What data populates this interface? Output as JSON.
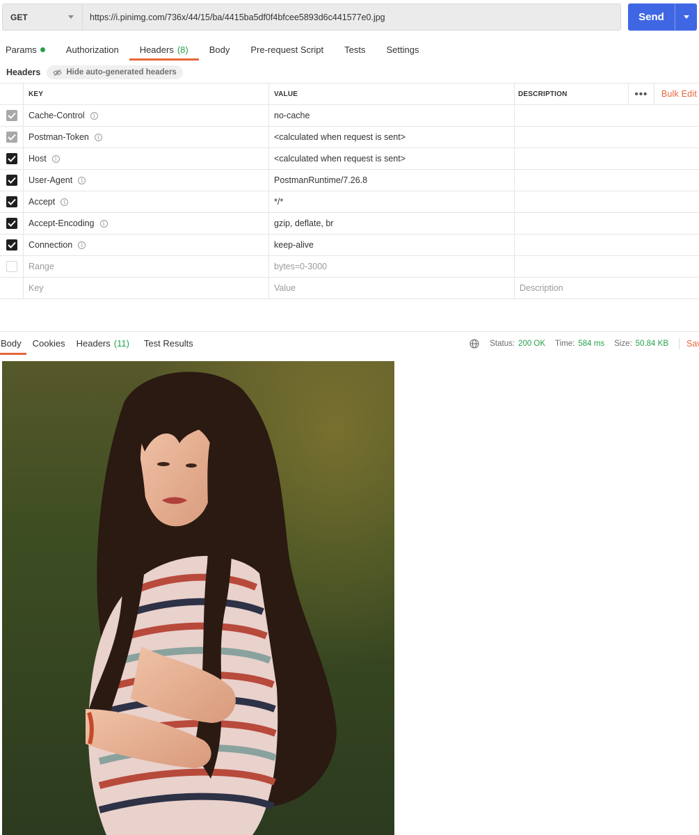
{
  "request": {
    "method": "GET",
    "url": "https://i.pinimg.com/736x/44/15/ba/4415ba5df0f4bfcee5893d6c441577e0.jpg",
    "send_label": "Send"
  },
  "request_tabs": [
    {
      "label": "Params"
    },
    {
      "label": "Authorization"
    },
    {
      "label": "Headers",
      "count": "(8)"
    },
    {
      "label": "Body"
    },
    {
      "label": "Pre-request Script"
    },
    {
      "label": "Tests"
    },
    {
      "label": "Settings"
    }
  ],
  "headers_section": {
    "title": "Headers",
    "hide_auto_label": "Hide auto-generated headers"
  },
  "table": {
    "columns": {
      "key": "KEY",
      "value": "VALUE",
      "description": "DESCRIPTION"
    },
    "more_label": "•••",
    "bulk_edit_label": "Bulk Edit",
    "rows": [
      {
        "key": "Cache-Control",
        "value": "no-cache",
        "state": "auto"
      },
      {
        "key": "Postman-Token",
        "value": "<calculated when request is sent>",
        "state": "auto"
      },
      {
        "key": "Host",
        "value": "<calculated when request is sent>",
        "state": "on"
      },
      {
        "key": "User-Agent",
        "value": "PostmanRuntime/7.26.8",
        "state": "on"
      },
      {
        "key": "Accept",
        "value": "*/*",
        "state": "on"
      },
      {
        "key": "Accept-Encoding",
        "value": "gzip, deflate, br",
        "state": "on"
      },
      {
        "key": "Connection",
        "value": "keep-alive",
        "state": "on"
      },
      {
        "key": "Range",
        "value": "bytes=0-3000",
        "state": "off"
      }
    ],
    "placeholders": {
      "key": "Key",
      "value": "Value",
      "description": "Description"
    }
  },
  "response": {
    "tabs": [
      {
        "label": "Body"
      },
      {
        "label": "Cookies"
      },
      {
        "label": "Headers",
        "count": "(11)"
      },
      {
        "label": "Test Results"
      }
    ],
    "status_label": "Status:",
    "status_value": "200 OK",
    "time_label": "Time:",
    "time_value": "584 ms",
    "size_label": "Size:",
    "size_value": "50.84 KB",
    "save_label": "Save Response"
  },
  "colors": {
    "accent": "#e6663a",
    "send": "#3f66e3",
    "success": "#26a14a"
  }
}
